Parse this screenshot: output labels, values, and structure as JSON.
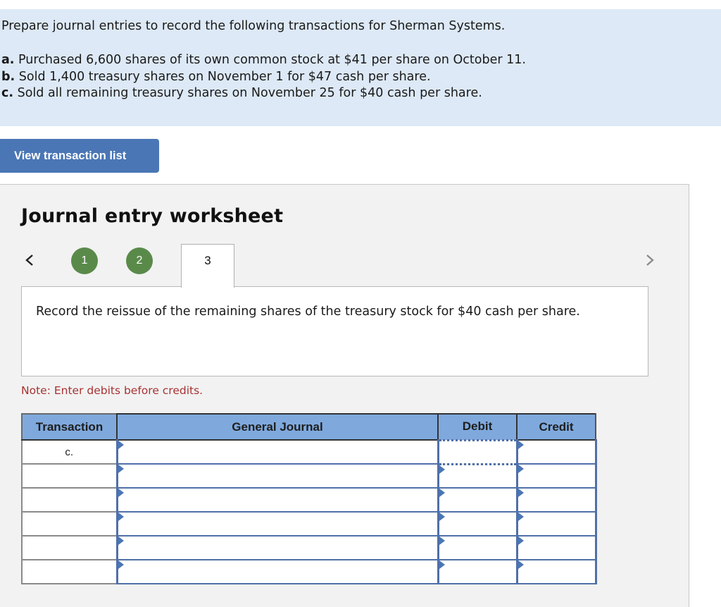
{
  "problem": {
    "intro": "Prepare journal entries to record the following transactions for Sherman Systems.",
    "transactions": [
      {
        "letter": "a.",
        "text": "Purchased 6,600 shares of its own common stock at $41 per share on October 11."
      },
      {
        "letter": "b.",
        "text": "Sold 1,400 treasury shares on November 1 for $47 cash per share."
      },
      {
        "letter": "c.",
        "text": "Sold all remaining treasury shares on November 25 for $40 cash per share."
      }
    ]
  },
  "view_button": {
    "label": "View transaction list"
  },
  "worksheet": {
    "title": "Journal entry worksheet",
    "nav": {
      "prev_icon": "chevron-left-icon",
      "next_icon": "chevron-right-icon"
    },
    "steps": [
      {
        "label": "1",
        "status": "completed"
      },
      {
        "label": "2",
        "status": "completed"
      },
      {
        "label": "3",
        "status": "active"
      }
    ],
    "instruction": "Record the reissue of the remaining shares of the treasury stock for $40 cash per share.",
    "note": "Note: Enter debits before credits.",
    "colors": {
      "step_complete": "#5a8a4a",
      "header_bg": "#7fa9dd",
      "note": "#a83232",
      "button": "#4a76b5"
    }
  },
  "journal": {
    "columns": [
      "Transaction",
      "General Journal",
      "Debit",
      "Credit"
    ],
    "rows": [
      {
        "transaction": "c.",
        "account": "",
        "debit": "",
        "credit": ""
      },
      {
        "transaction": "",
        "account": "",
        "debit": "",
        "credit": ""
      },
      {
        "transaction": "",
        "account": "",
        "debit": "",
        "credit": ""
      },
      {
        "transaction": "",
        "account": "",
        "debit": "",
        "credit": ""
      },
      {
        "transaction": "",
        "account": "",
        "debit": "",
        "credit": ""
      },
      {
        "transaction": "",
        "account": "",
        "debit": "",
        "credit": ""
      }
    ]
  }
}
